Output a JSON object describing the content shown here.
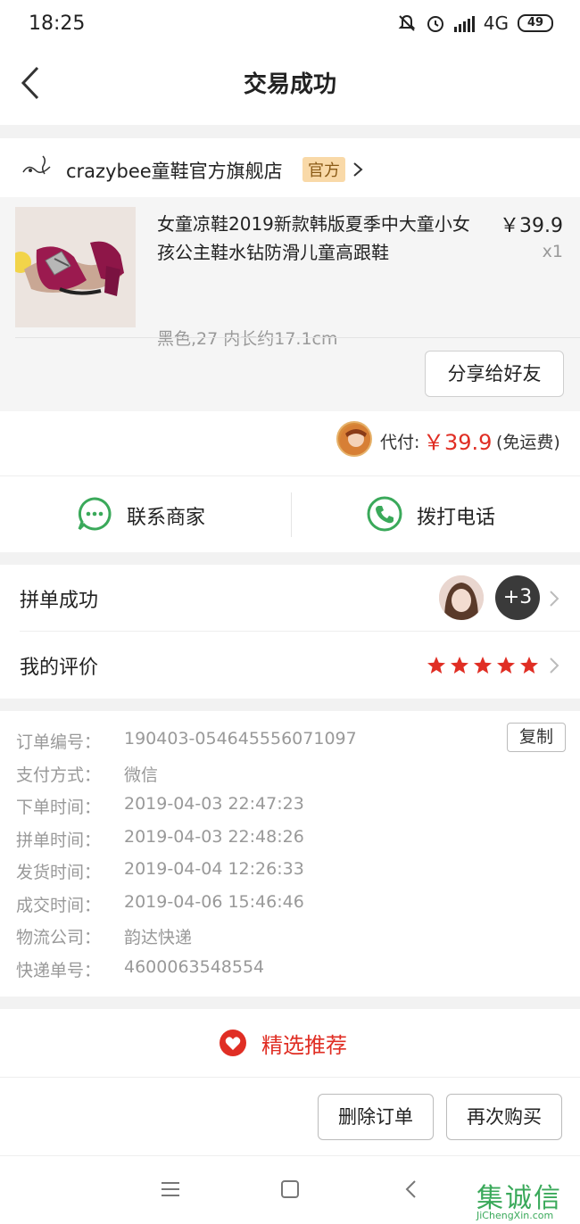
{
  "status_bar": {
    "time": "18:25",
    "network": "4G",
    "battery": "49"
  },
  "header": {
    "title": "交易成功"
  },
  "store": {
    "logo_text": "Crazy·bee",
    "name": "crazybee童鞋官方旗舰店",
    "badge": "官方"
  },
  "goods": {
    "name": "女童凉鞋2019新款韩版夏季中大童小女孩公主鞋水钻防滑儿童高跟鞋",
    "spec": "黑色,27 内长约17.1cm",
    "price": "￥39.9",
    "qty": "x1",
    "share_label": "分享给好友"
  },
  "payment": {
    "label": "代付:",
    "amount": "￥39.9",
    "note": "(免运费)"
  },
  "contact": {
    "merchant_label": "联系商家",
    "phone_label": "拨打电话"
  },
  "group": {
    "success_label": "拼单成功",
    "more_count": "+3",
    "review_label": "我的评价",
    "rating": 5
  },
  "order_info": {
    "copy_label": "复制",
    "rows": [
      {
        "key": "订单编号：",
        "value": "190403-054645556071097"
      },
      {
        "key": "支付方式：",
        "value": "微信"
      },
      {
        "key": "下单时间：",
        "value": "2019-04-03 22:47:23"
      },
      {
        "key": "拼单时间：",
        "value": "2019-04-03 22:48:26"
      },
      {
        "key": "发货时间：",
        "value": "2019-04-04 12:26:33"
      },
      {
        "key": "成交时间：",
        "value": "2019-04-06 15:46:46"
      },
      {
        "key": "物流公司：",
        "value": "韵达快递"
      },
      {
        "key": "快递单号：",
        "value": "4600063548554"
      }
    ]
  },
  "recommend": {
    "label": "精选推荐"
  },
  "actions": {
    "delete_label": "删除订单",
    "rebuy_label": "再次购买"
  },
  "watermark": {
    "mark": "集诚信",
    "site": "JiChengXin.com"
  },
  "colors": {
    "accent": "#e02e24",
    "wechat_green": "#3aa95a",
    "badge_bg": "#f9d9a8"
  },
  "icons": [
    "mute-icon",
    "alarm-icon",
    "signal-icon",
    "back-arrow-icon",
    "chevron-right-icon",
    "chat-icon",
    "phone-icon",
    "star-icon",
    "recommend-heart-icon",
    "menu-icon",
    "home-square-icon",
    "back-nav-icon"
  ]
}
